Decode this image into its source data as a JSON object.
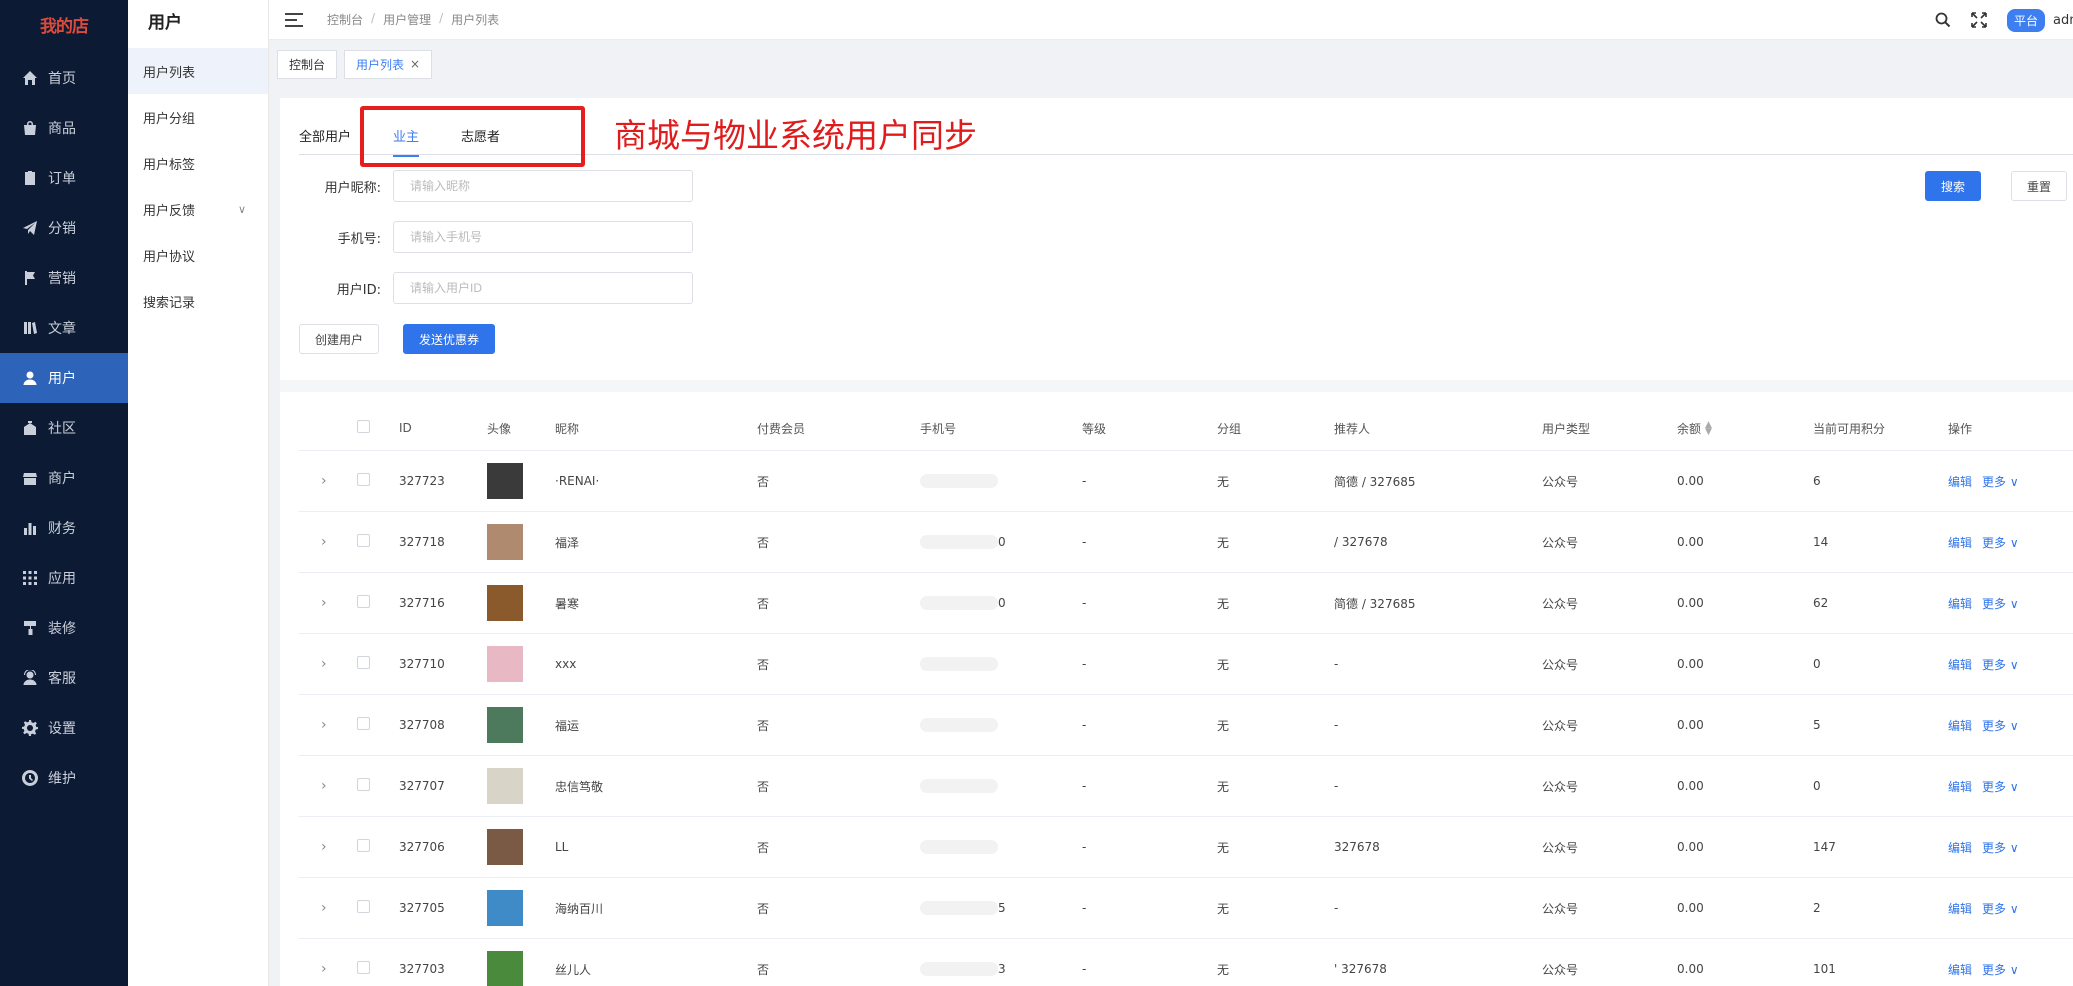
{
  "app": {
    "logo": "我的店"
  },
  "sidebar": {
    "items": [
      {
        "label": "首页",
        "icon": "home-icon"
      },
      {
        "label": "商品",
        "icon": "shopping-bag-icon"
      },
      {
        "label": "订单",
        "icon": "clipboard-icon"
      },
      {
        "label": "分销",
        "icon": "paper-plane-icon"
      },
      {
        "label": "营销",
        "icon": "flag-icon"
      },
      {
        "label": "文章",
        "icon": "book-icon"
      },
      {
        "label": "用户",
        "icon": "user-icon"
      },
      {
        "label": "社区",
        "icon": "building-icon"
      },
      {
        "label": "商户",
        "icon": "store-icon"
      },
      {
        "label": "财务",
        "icon": "bar-chart-icon"
      },
      {
        "label": "应用",
        "icon": "grid-icon"
      },
      {
        "label": "装修",
        "icon": "paint-roller-icon"
      },
      {
        "label": "客服",
        "icon": "headset-icon"
      },
      {
        "label": "设置",
        "icon": "gear-icon"
      },
      {
        "label": "维护",
        "icon": "tool-icon"
      }
    ],
    "active_index": 6
  },
  "submenu": {
    "title": "用户",
    "items": [
      "用户列表",
      "用户分组",
      "用户标签",
      "用户反馈",
      "用户协议",
      "搜索记录"
    ]
  },
  "header": {
    "breadcrumb": [
      "控制台",
      "用户管理",
      "用户列表"
    ],
    "platform_badge": "平台",
    "user_name": "admin"
  },
  "tagsbar": {
    "tags": [
      "控制台",
      "用户列表"
    ]
  },
  "tabs": [
    "全部用户",
    "业主",
    "志愿者"
  ],
  "annotation": "商城与物业系统用户同步",
  "filters": {
    "nickname_label": "用户昵称:",
    "nickname_placeholder": "请输入昵称",
    "phone_label": "手机号:",
    "phone_placeholder": "请输入手机号",
    "userid_label": "用户ID:",
    "userid_placeholder": "请输入用户ID",
    "search_button": "搜索",
    "reset_button": "重置"
  },
  "actions": {
    "create_user": "创建用户",
    "send_coupon": "发送优惠券"
  },
  "table": {
    "columns": [
      "ID",
      "头像",
      "昵称",
      "付费会员",
      "手机号",
      "等级",
      "分组",
      "推荐人",
      "用户类型",
      "余额",
      "当前可用积分",
      "操作"
    ],
    "edit_label": "编辑",
    "more_label": "更多",
    "rows": [
      {
        "id": "327723",
        "nickname": "·RENAI·",
        "paid": "否",
        "phone": "",
        "level": "-",
        "group": "无",
        "referrer": "简德 / 327685",
        "type": "公众号",
        "balance": "0.00",
        "points": "6",
        "avatar_color": "#3a3a3a"
      },
      {
        "id": "327718",
        "nickname": "福泽",
        "paid": "否",
        "phone": "0",
        "level": "-",
        "group": "无",
        "referrer": "/ 327678",
        "type": "公众号",
        "balance": "0.00",
        "points": "14",
        "avatar_color": "#b08a6e"
      },
      {
        "id": "327716",
        "nickname": "暑寒",
        "paid": "否",
        "phone": "0",
        "level": "-",
        "group": "无",
        "referrer": "简德 / 327685",
        "type": "公众号",
        "balance": "0.00",
        "points": "62",
        "avatar_color": "#8a5a2c"
      },
      {
        "id": "327710",
        "nickname": "xxx",
        "paid": "否",
        "phone": "",
        "level": "-",
        "group": "无",
        "referrer": "-",
        "type": "公众号",
        "balance": "0.00",
        "points": "0",
        "avatar_color": "#e8b8c4"
      },
      {
        "id": "327708",
        "nickname": "福运",
        "paid": "否",
        "phone": "",
        "level": "-",
        "group": "无",
        "referrer": "-",
        "type": "公众号",
        "balance": "0.00",
        "points": "5",
        "avatar_color": "#4d7a5c"
      },
      {
        "id": "327707",
        "nickname": "忠信笃敬",
        "paid": "否",
        "phone": "",
        "level": "-",
        "group": "无",
        "referrer": "-",
        "type": "公众号",
        "balance": "0.00",
        "points": "0",
        "avatar_color": "#d9d4c8"
      },
      {
        "id": "327706",
        "nickname": "LL",
        "paid": "否",
        "phone": "",
        "level": "-",
        "group": "无",
        "referrer": "327678",
        "type": "公众号",
        "balance": "0.00",
        "points": "147",
        "avatar_color": "#7a5a44"
      },
      {
        "id": "327705",
        "nickname": "海纳百川",
        "paid": "否",
        "phone": "5",
        "level": "-",
        "group": "无",
        "referrer": "-",
        "type": "公众号",
        "balance": "0.00",
        "points": "2",
        "avatar_color": "#3f8bc7"
      },
      {
        "id": "327703",
        "nickname": "丝儿人",
        "paid": "否",
        "phone": "3",
        "level": "-",
        "group": "无",
        "referrer": "' 327678",
        "type": "公众号",
        "balance": "0.00",
        "points": "101",
        "avatar_color": "#4a8a3c"
      }
    ]
  },
  "colors": {
    "sidebar_bg": "#0c1a33",
    "active_blue": "#2d63b8",
    "primary": "#2f74eb",
    "annotation_red": "#e01b1b"
  }
}
